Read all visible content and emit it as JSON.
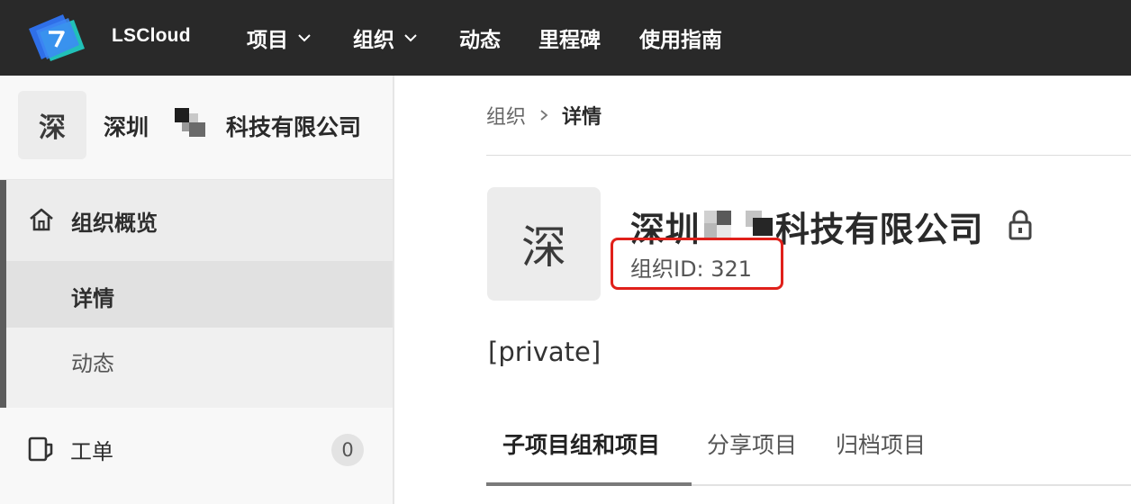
{
  "navbar": {
    "brand": "LSCloud",
    "items": [
      {
        "label": "项目",
        "has_dropdown": true
      },
      {
        "label": "组织",
        "has_dropdown": true
      },
      {
        "label": "动态",
        "has_dropdown": false
      },
      {
        "label": "里程碑",
        "has_dropdown": false
      },
      {
        "label": "使用指南",
        "has_dropdown": false
      }
    ]
  },
  "sidebar": {
    "org_avatar_char": "深",
    "org_name_prefix": "深圳",
    "org_name_suffix": "科技有限公司",
    "group": {
      "title": "组织概览",
      "icon": "home-icon",
      "items": [
        {
          "label": "详情",
          "active": true
        },
        {
          "label": "动态",
          "active": false
        }
      ]
    },
    "work_orders": {
      "label": "工单",
      "icon": "work-order-icon",
      "count": "0"
    }
  },
  "breadcrumb": {
    "parent": "组织",
    "current": "详情"
  },
  "org": {
    "avatar_char": "深",
    "name_prefix": "深圳",
    "name_suffix": "科技有限公司",
    "id_text": "组织ID: 321",
    "visibility": "[private]",
    "lock_icon": "lock-icon"
  },
  "tabs": [
    {
      "label": "子项目组和项目",
      "active": true
    },
    {
      "label": "分享项目",
      "active": false
    },
    {
      "label": "归档项目",
      "active": false
    }
  ],
  "colors": {
    "navbar_bg": "#292929",
    "highlight": "#e0201a",
    "logo_blue": "#2f6fe8",
    "logo_cyan": "#20d0c8"
  }
}
